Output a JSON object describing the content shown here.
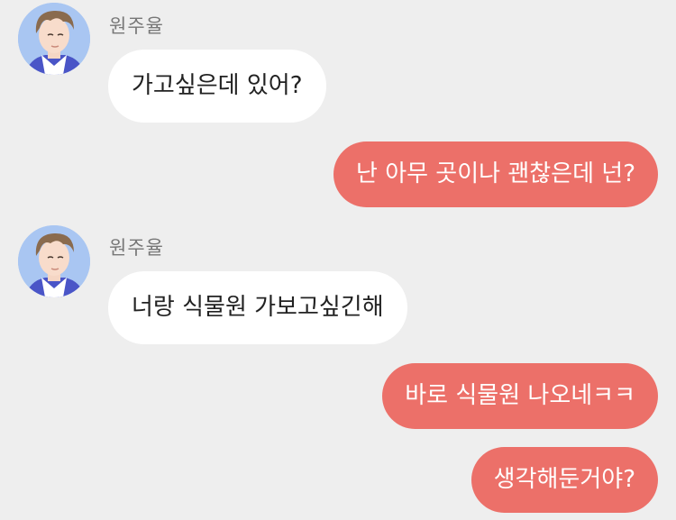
{
  "chat": {
    "messages": [
      {
        "direction": "incoming",
        "sender": "원주율",
        "avatar_icon": "user-avatar-icon",
        "text": "가고싶은데 있어?"
      },
      {
        "direction": "outgoing",
        "text": "난 아무 곳이나 괜찮은데 넌?"
      },
      {
        "direction": "incoming",
        "sender": "원주율",
        "avatar_icon": "user-avatar-icon",
        "text": "너랑 식물원 가보고싶긴해"
      },
      {
        "direction": "outgoing",
        "text": "바로 식물원 나오네ㅋㅋ"
      },
      {
        "direction": "outgoing",
        "text": "생각해둔거야?"
      }
    ]
  },
  "colors": {
    "background": "#eeeeee",
    "incoming_bubble": "#ffffff",
    "outgoing_bubble": "#ec7069",
    "sender_name": "#777777",
    "avatar_background": "#a9c6f2"
  }
}
